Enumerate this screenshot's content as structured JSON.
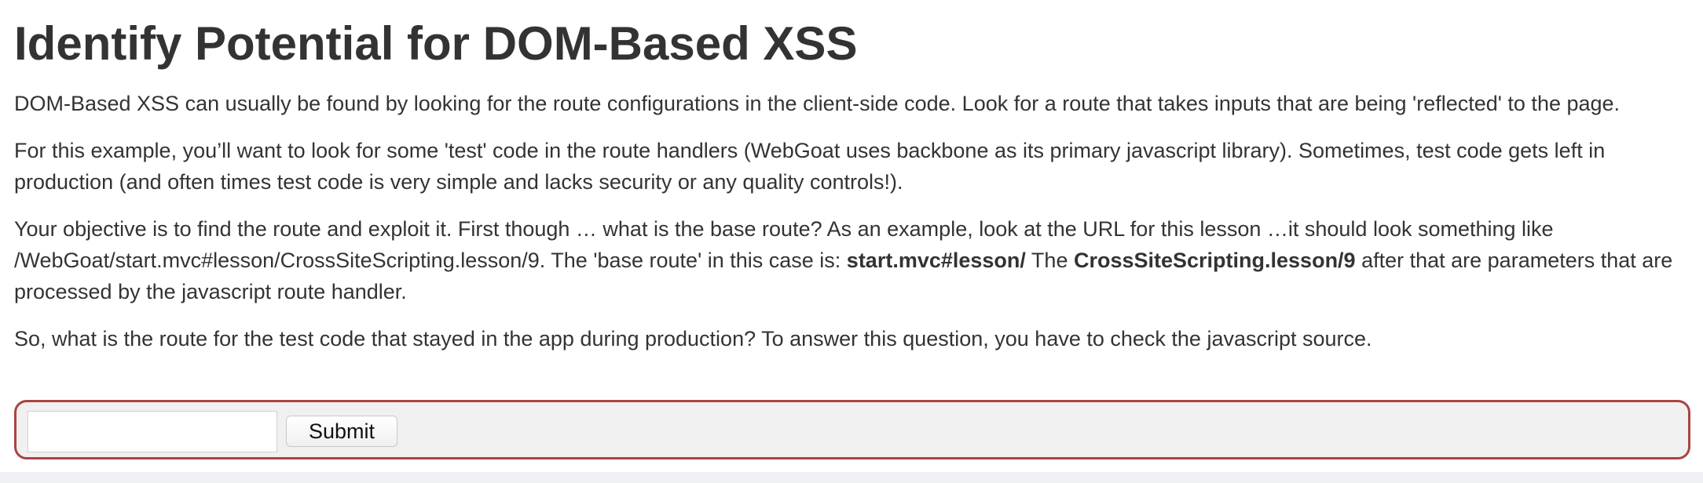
{
  "lesson": {
    "title": "Identify Potential for DOM-Based XSS",
    "para1": "DOM-Based XSS can usually be found by looking for the route configurations in the client-side code. Look for a route that takes inputs that are being 'reflected' to the page.",
    "para2": "For this example, you’ll want to look for some 'test' code in the route handlers (WebGoat uses backbone as its primary javascript library). Sometimes, test code gets left in production (and often times test code is very simple and lacks security or any quality controls!).",
    "para3": {
      "text_a": "Your objective is to find the route and exploit it. First though … what is the base route? As an example, look at the URL for this lesson …it should look something like /WebGoat/start.mvc#lesson/CrossSiteScripting.lesson/9. The 'base route' in this case is: ",
      "bold_a": "start.mvc#lesson/",
      "text_b": " The ",
      "bold_b": "CrossSiteScripting.lesson/9",
      "text_c": " after that are parameters that are processed by the javascript route handler."
    },
    "para4": "So, what is the route for the test code that stayed in the app during production? To answer this question, you have to check the javascript source."
  },
  "form": {
    "input_value": "",
    "input_placeholder": "",
    "submit_label": "Submit",
    "border_color": "#a94442",
    "background_color": "#f0f0f0"
  }
}
